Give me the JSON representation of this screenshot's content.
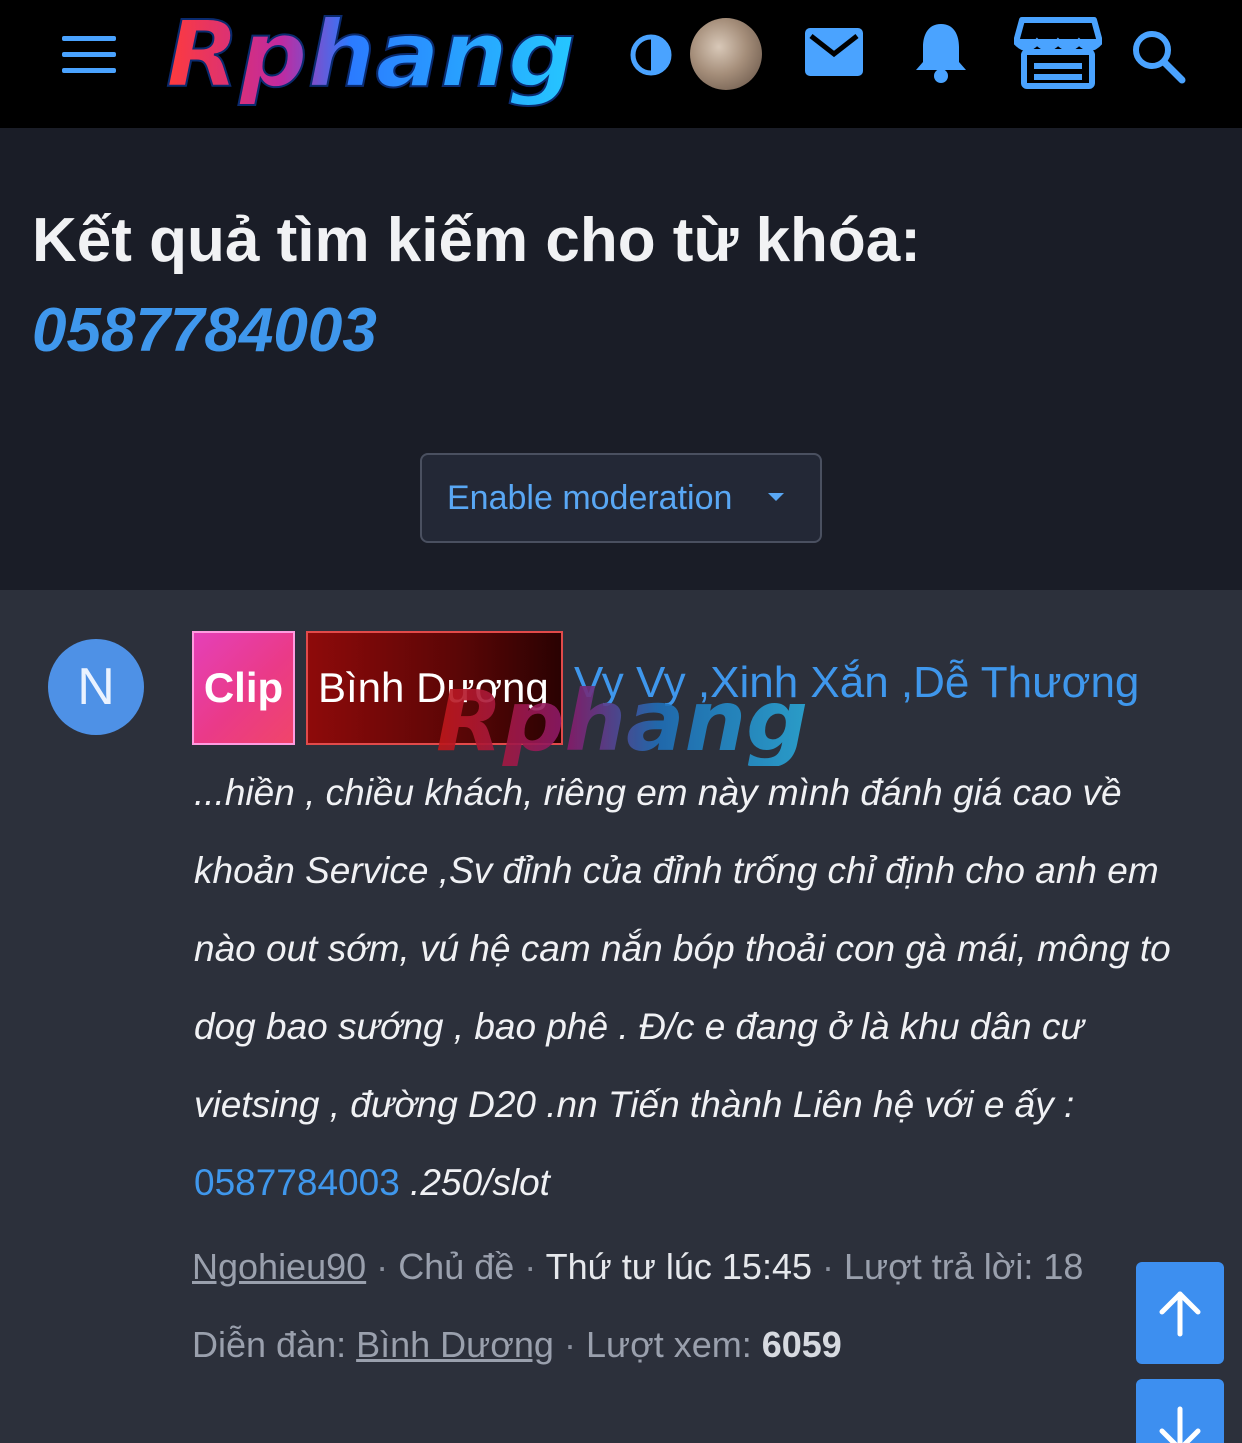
{
  "navbar": {
    "logo_text": "Rphang",
    "icons": [
      "menu-icon",
      "theme-toggle-icon",
      "user-avatar",
      "mail-icon",
      "bell-icon",
      "store-icon",
      "search-icon"
    ]
  },
  "header": {
    "title": "Kết quả tìm kiếm cho từ khóa:",
    "keyword": "0587784003",
    "moderation_button": "Enable moderation"
  },
  "result": {
    "avatar_letter": "N",
    "prefix_1": "Clip",
    "prefix_2": "Bình Dương",
    "title": "Vy Vy ,Xinh Xắn ,Dễ Thương",
    "snippet_before": "...hiền , chiều khách, riêng em này mình đánh giá cao về khoản Service ,Sv đỉnh của đỉnh trống chỉ định cho anh em nào out sớm, vú hệ cam nắn bóp thoải con gà mái, mông to dog bao sướng , bao phê . Đ/c e đang ở là khu dân cư vietsing , đường D20 .nn Tiến thành Liên hệ với e ấy : ",
    "snippet_highlight": "0587784003",
    "snippet_after": " .250/slot",
    "author": "Ngohieu90",
    "type": "Chủ đề",
    "date": "Thứ tư lúc 15:45",
    "replies_label": "Lượt trả lời: 18",
    "forum_label": "Diễn đàn:",
    "forum": "Bình Dương",
    "views_label": "Lượt xem:",
    "views": "6059",
    "sep": "·"
  },
  "colors": {
    "accent": "#3f97ec",
    "navbar_bg": "#000000",
    "header_bg": "#1a1d27",
    "body_bg": "#2c303b",
    "scroll_button": "#3d8ff0"
  }
}
